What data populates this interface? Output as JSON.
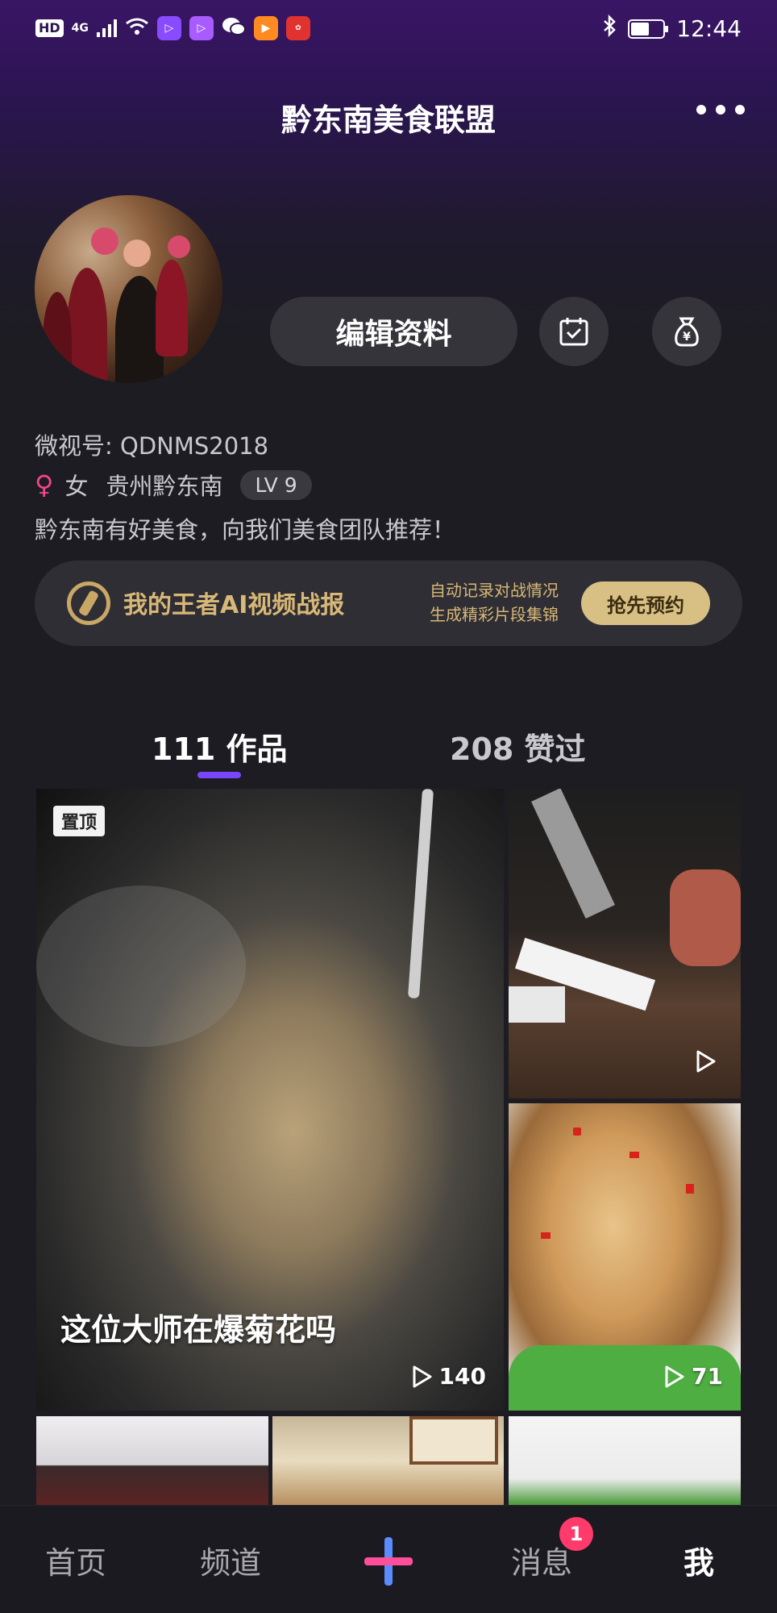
{
  "status_bar": {
    "hd": "HD",
    "network": "4G",
    "time": "12:44"
  },
  "header": {
    "title": "黔东南美食联盟"
  },
  "profile": {
    "edit_label": "编辑资料",
    "wechat_id": "微视号: QDNMS2018",
    "gender": "女",
    "location": "贵州黔东南",
    "level": "LV 9",
    "bio": "黔东南有好美食，向我们美食团队推荐！"
  },
  "banner": {
    "title": "我的王者AI视频战报",
    "sub_line1": "自动记录对战情况",
    "sub_line2": "生成精彩片段集锦",
    "button": "抢先预约",
    "accent": "#d8bf84"
  },
  "tabs": [
    {
      "label": "111 作品",
      "active": true
    },
    {
      "label": "208 赞过",
      "active": false
    }
  ],
  "videos": [
    {
      "pinned_label": "置顶",
      "title": "这位大师在爆菊花吗",
      "plays": "140"
    },
    {
      "plays": ""
    },
    {
      "plays": "71"
    }
  ],
  "bottom_nav": {
    "home": "首页",
    "channel": "频道",
    "messages": "消息",
    "messages_badge": "1",
    "me": "我",
    "active": "me"
  }
}
